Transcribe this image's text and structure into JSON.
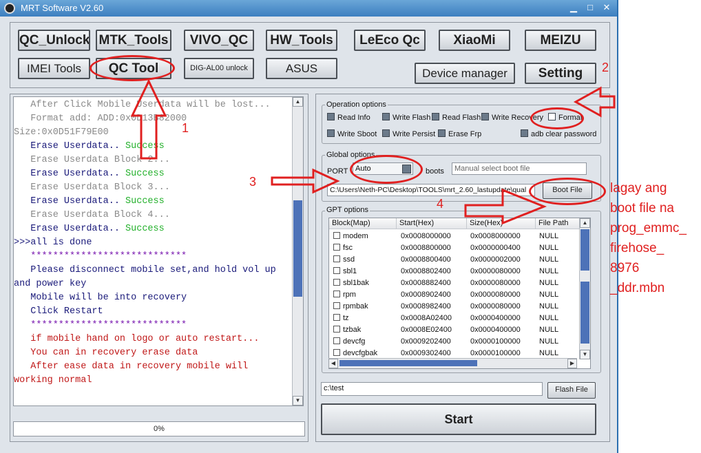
{
  "window": {
    "title": "MRT Software V2.60",
    "controls": [
      "minimize",
      "maximize",
      "close"
    ]
  },
  "toolbar": {
    "row1": [
      "QC_Unlock",
      "MTK_Tools",
      "VIVO_QC",
      "HW_Tools",
      "LeEco Qc",
      "XiaoMi",
      "MEIZU"
    ],
    "row2": [
      "IMEI Tools",
      "QC Tool",
      "DIG-AL00 unlock",
      "ASUS"
    ],
    "device_manager": "Device manager",
    "setting": "Setting"
  },
  "log": {
    "lines": [
      {
        "text": "   After Click Mobile Userdata will be lost...",
        "color": "#8a8a8a"
      },
      {
        "text": "   Format add: ADD:0x0D13B82000",
        "color": "#8a8a8a"
      },
      {
        "text": "Size:0x0D51F79E00",
        "color": "#8a8a8a"
      },
      {
        "text": "   Erase Userdata.. ",
        "color": "#1a1a7a",
        "extra": "Success",
        "extra_color": "#22b02a"
      },
      {
        "text": "   Erase Userdata Block 2...",
        "color": "#8a8a8a"
      },
      {
        "text": "   Erase Userdata.. ",
        "color": "#1a1a7a",
        "extra": "Success",
        "extra_color": "#22b02a"
      },
      {
        "text": "   Erase Userdata Block 3...",
        "color": "#8a8a8a"
      },
      {
        "text": "   Erase Userdata.. ",
        "color": "#1a1a7a",
        "extra": "Success",
        "extra_color": "#22b02a"
      },
      {
        "text": "   Erase Userdata Block 4...",
        "color": "#8a8a8a"
      },
      {
        "text": "   Erase Userdata.. ",
        "color": "#1a1a7a",
        "extra": "Success",
        "extra_color": "#22b02a"
      },
      {
        "text": ">>>all is done",
        "color": "#1a1a7a"
      },
      {
        "text": "   ****************************",
        "color": "#7a1ab0"
      },
      {
        "text": "   Please disconnect mobile set,and hold vol up",
        "color": "#1a1a7a"
      },
      {
        "text": "and power key",
        "color": "#1a1a7a"
      },
      {
        "text": "   Mobile will be into recovery",
        "color": "#1a1a7a"
      },
      {
        "text": "   Click Restart",
        "color": "#1a1a7a"
      },
      {
        "text": "   ****************************",
        "color": "#7a1ab0"
      },
      {
        "text": "   if mobile hand on logo or auto restart...",
        "color": "#c01818"
      },
      {
        "text": "   You can in recovery erase data",
        "color": "#c01818"
      },
      {
        "text": "   After ease data in recovery mobile will",
        "color": "#c01818"
      },
      {
        "text": "working normal",
        "color": "#c01818"
      }
    ]
  },
  "progress": {
    "label": "0%",
    "value": 0
  },
  "operation_options": {
    "title": "Operation options",
    "row1": [
      "Read Info",
      "Write Flash",
      "Read Flash",
      "Write Recovery",
      "Format"
    ],
    "row2": [
      "Write Sboot",
      "Write Persist",
      "Erase Frp",
      "adb clear password"
    ]
  },
  "global_options": {
    "title": "Global options",
    "port_label": "PORT",
    "port_value": "Auto",
    "boots_label": "boots",
    "boot_placeholder": "Manual select boot file",
    "path": "C:\\Users\\Neth-PC\\Desktop\\TOOLS\\mrt_2.60_lastupdate\\qual",
    "boot_file_button": "Boot File"
  },
  "gpt_options": {
    "title": "GPT options",
    "columns": [
      "Block(Map)",
      "Start(Hex)",
      "Size(Hex)",
      "File Path"
    ],
    "rows": [
      [
        "modem",
        "0x0008000000",
        "0x0008000000",
        "NULL"
      ],
      [
        "fsc",
        "0x0008800000",
        "0x0000000400",
        "NULL"
      ],
      [
        "ssd",
        "0x0008800400",
        "0x0000002000",
        "NULL"
      ],
      [
        "sbl1",
        "0x0008802400",
        "0x0000080000",
        "NULL"
      ],
      [
        "sbl1bak",
        "0x0008882400",
        "0x0000080000",
        "NULL"
      ],
      [
        "rpm",
        "0x0008902400",
        "0x0000080000",
        "NULL"
      ],
      [
        "rpmbak",
        "0x0008982400",
        "0x0000080000",
        "NULL"
      ],
      [
        "tz",
        "0x0008A02400",
        "0x0000400000",
        "NULL"
      ],
      [
        "tzbak",
        "0x0008E02400",
        "0x0000400000",
        "NULL"
      ],
      [
        "devcfg",
        "0x0009202400",
        "0x0000100000",
        "NULL"
      ],
      [
        "devcfgbak",
        "0x0009302400",
        "0x0000100000",
        "NULL"
      ]
    ]
  },
  "flash": {
    "path": "c:\\test",
    "button": "Flash File"
  },
  "start_button": "Start",
  "annotations": {
    "steps": [
      "1",
      "2",
      "3",
      "4"
    ],
    "note": [
      "lagay ang",
      "boot file na",
      "prog_emmc_",
      "firehose_",
      "8976",
      "_ddr.mbn"
    ]
  },
  "colors": {
    "annotation_red": "#e02020",
    "success_green": "#22b02a",
    "scroll_blue": "#4d72b8"
  }
}
